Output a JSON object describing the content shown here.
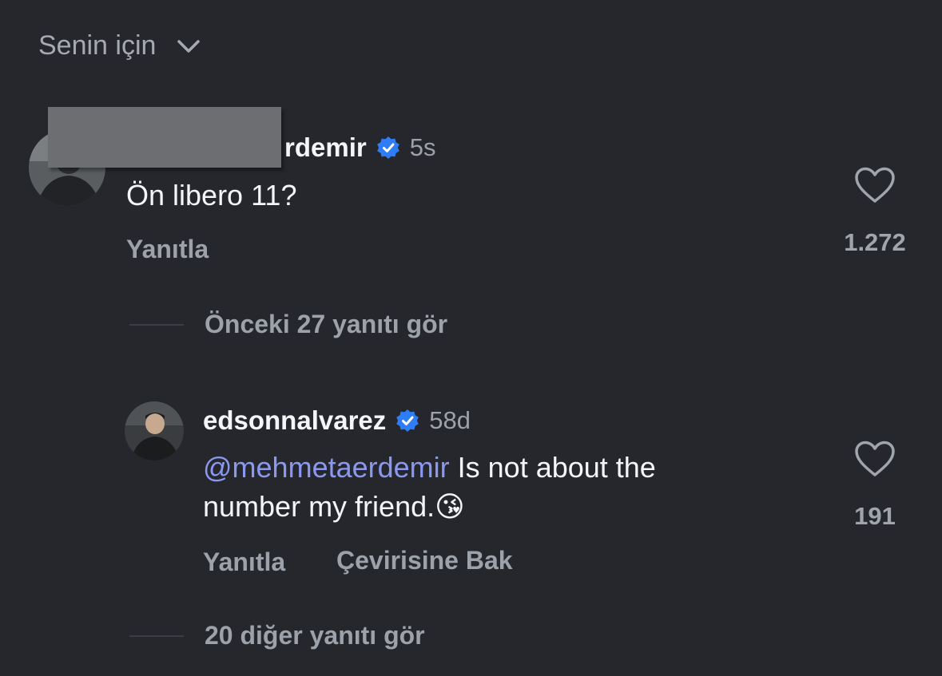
{
  "header": {
    "sort_label": "Senin için",
    "chevron_icon": "chevron-down-icon"
  },
  "colors": {
    "background": "#25272d",
    "verified_blue": "#2f7df6",
    "mention": "#8b98f0",
    "muted_text": "#9da1a9"
  },
  "comments": [
    {
      "username_visible": "rdemir",
      "verified": true,
      "time": "5s",
      "text": "Ön libero 11?",
      "reply_label": "Yanıtla",
      "likes": "1.272",
      "redacted": true
    }
  ],
  "replies_toggle": {
    "previous_label": "Önceki 27 yanıtı gör"
  },
  "reply": {
    "username": "edsonnalvarez",
    "verified": true,
    "time": "58d",
    "mention": "@mehmetaerdemir",
    "text_line1": " Is not about the",
    "text_line2": "number my friend.",
    "emoji": "😘",
    "reply_label": "Yanıtla",
    "translate_label": "Çevirisine Bak",
    "likes": "191"
  },
  "more_replies": {
    "label": "20 diğer yanıtı gör"
  }
}
